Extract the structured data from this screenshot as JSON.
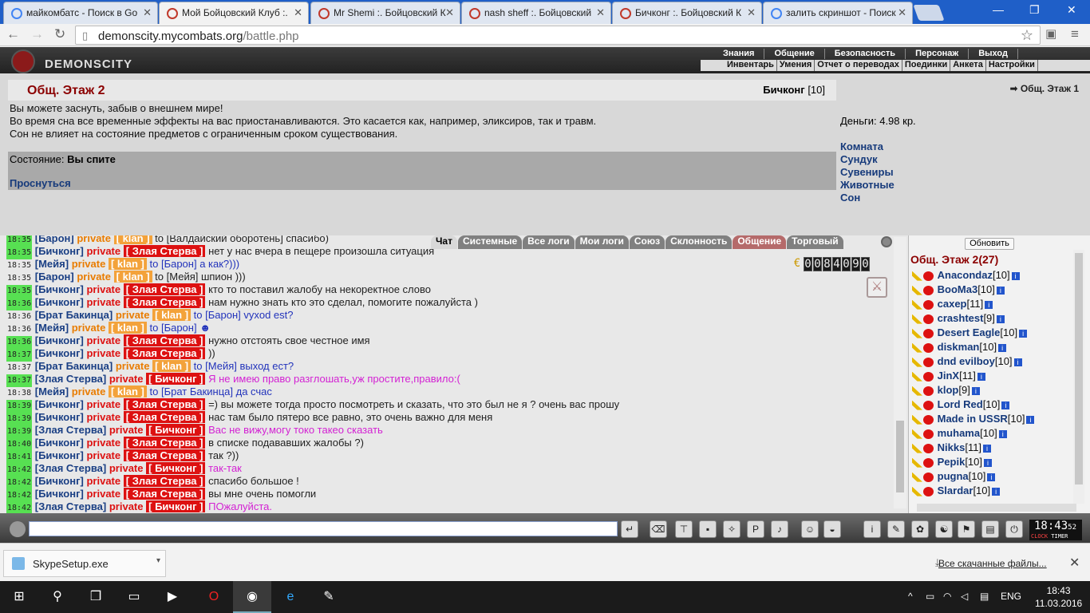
{
  "browser": {
    "tabs": [
      {
        "title": "майкомбатс - Поиск в Go",
        "icon": "google-icon"
      },
      {
        "title": "Мой Бойцовский Клуб :.",
        "icon": "combats-icon",
        "active": true
      },
      {
        "title": "Mr Shemi :. Бойцовский К",
        "icon": "combats-icon"
      },
      {
        "title": "nash sheff :. Бойцовский",
        "icon": "combats-icon"
      },
      {
        "title": "Бичконг :. Бойцовский К",
        "icon": "combats-icon"
      },
      {
        "title": "залить скриншот - Поиск",
        "icon": "google-icon"
      }
    ],
    "url_domain": "demonscity.mycombats.org",
    "url_path": "/battle.php"
  },
  "game": {
    "logo_text": "DEMONSCITY",
    "menu_top": [
      "Знания",
      "Общение",
      "Безопасность",
      "Персонаж",
      "Выход"
    ],
    "menu_sub": [
      "Инвентарь",
      "Умения",
      "Отчет о переводах",
      "Поединки",
      "Анкета",
      "Настройки"
    ],
    "room_title": "Общ. Этаж 2",
    "char_name": "Бичконг",
    "char_level": "[10]",
    "desc": [
      "Вы можете заснуть, забыв о внешнем мире!",
      "Во время сна все временные эффекты на вас приостанавливаются. Это касается как, например, эликсиров, так и травм.",
      "Сон не влияет на состояние предметов с ограниченным сроком существования."
    ],
    "state_label": "Состояние:",
    "state_value": "Вы спите",
    "wake_link": "Проснуться",
    "current_room": "Общ. Этаж 1",
    "money": "Деньги: 4.98 кр.",
    "room_links": [
      "Комната",
      "Сундук",
      "Сувениры",
      "Животные",
      "Сон"
    ]
  },
  "chat": {
    "tabs": [
      "Чат",
      "Системные",
      "Все логи",
      "Мои логи",
      "Союз",
      "Склонность",
      "Общение",
      "Торговый"
    ],
    "counter_digits": [
      "0",
      "0",
      "8",
      "4",
      "0",
      "9",
      "0"
    ],
    "messages": [
      {
        "time": "18:35",
        "hl": true,
        "nick": "Барон",
        "priv": "private",
        "tgt": "klan",
        "pc": "org",
        "text": "to [Валдайский оборотень] спасибо)",
        "mc": "dark"
      },
      {
        "time": "18:35",
        "hl": true,
        "nick": "Бичконг",
        "priv": "private",
        "tgt": "Злая Стерва",
        "pc": "red",
        "text": "нет у нас вчера в пещере произошла ситуация",
        "mc": "dark"
      },
      {
        "time": "18:35",
        "hl": false,
        "nick": "Мейя",
        "priv": "private",
        "tgt": "klan",
        "pc": "org",
        "text": "to [Барон] а как?)))",
        "mc": "blue"
      },
      {
        "time": "18:35",
        "hl": false,
        "nick": "Барон",
        "priv": "private",
        "tgt": "klan",
        "pc": "org",
        "text": "to [Мейя] шпион )))",
        "mc": "dark"
      },
      {
        "time": "18:35",
        "hl": true,
        "nick": "Бичконг",
        "priv": "private",
        "tgt": "Злая Стерва",
        "pc": "red",
        "text": "кто то поставил жалобу на некоректное слово",
        "mc": "dark"
      },
      {
        "time": "18:36",
        "hl": true,
        "nick": "Бичконг",
        "priv": "private",
        "tgt": "Злая Стерва",
        "pc": "red",
        "text": "нам нужно знать кто это сделал, помогите пожалуйста )",
        "mc": "dark"
      },
      {
        "time": "18:36",
        "hl": false,
        "nick": "Брат Бакинца",
        "priv": "private",
        "tgt": "klan",
        "pc": "org",
        "text": "to [Барон] vyxod est?",
        "mc": "blue"
      },
      {
        "time": "18:36",
        "hl": false,
        "nick": "Мейя",
        "priv": "private",
        "tgt": "klan",
        "pc": "org",
        "text": "to [Барон] ☻",
        "mc": "blue"
      },
      {
        "time": "18:36",
        "hl": true,
        "nick": "Бичконг",
        "priv": "private",
        "tgt": "Злая Стерва",
        "pc": "red",
        "text": "нужно отстоять свое честное имя",
        "mc": "dark"
      },
      {
        "time": "18:37",
        "hl": true,
        "nick": "Бичконг",
        "priv": "private",
        "tgt": "Злая Стерва",
        "pc": "red",
        "text": "))",
        "mc": "dark"
      },
      {
        "time": "18:37",
        "hl": false,
        "nick": "Брат Бакинца",
        "priv": "private",
        "tgt": "klan",
        "pc": "org",
        "text": "to [Мейя] выход ест?",
        "mc": "blue"
      },
      {
        "time": "18:37",
        "hl": true,
        "nick": "Злая Стерва",
        "priv": "private",
        "tgt": "Бичконг",
        "pc": "red",
        "text": "Я не имею право разглошать,уж простите,правило:(",
        "mc": "pink"
      },
      {
        "time": "18:38",
        "hl": false,
        "nick": "Мейя",
        "priv": "private",
        "tgt": "klan",
        "pc": "org",
        "text": "to [Брат Бакинца] да счас",
        "mc": "blue"
      },
      {
        "time": "18:39",
        "hl": true,
        "nick": "Бичконг",
        "priv": "private",
        "tgt": "Злая Стерва",
        "pc": "red",
        "text": "=) вы можете тогда просто посмотреть и сказать, что это был не я ? очень вас прошу",
        "mc": "dark"
      },
      {
        "time": "18:39",
        "hl": true,
        "nick": "Бичконг",
        "priv": "private",
        "tgt": "Злая Стерва",
        "pc": "red",
        "text": "нас там было пятеро все равно, это очень важно для меня",
        "mc": "dark"
      },
      {
        "time": "18:39",
        "hl": true,
        "nick": "Злая Стерва",
        "priv": "private",
        "tgt": "Бичконг",
        "pc": "red",
        "text": "Вас не вижу,могу токо такео сказать",
        "mc": "pink"
      },
      {
        "time": "18:40",
        "hl": true,
        "nick": "Бичконг",
        "priv": "private",
        "tgt": "Злая Стерва",
        "pc": "red",
        "text": "в списке подававших жалобы ?)",
        "mc": "dark"
      },
      {
        "time": "18:41",
        "hl": true,
        "nick": "Бичконг",
        "priv": "private",
        "tgt": "Злая Стерва",
        "pc": "red",
        "text": "так ?))",
        "mc": "dark"
      },
      {
        "time": "18:42",
        "hl": true,
        "nick": "Злая Стерва",
        "priv": "private",
        "tgt": "Бичконг",
        "pc": "red",
        "text": "так-так",
        "mc": "pink"
      },
      {
        "time": "18:42",
        "hl": true,
        "nick": "Бичконг",
        "priv": "private",
        "tgt": "Злая Стерва",
        "pc": "red",
        "text": "спасибо большое !",
        "mc": "dark"
      },
      {
        "time": "18:42",
        "hl": true,
        "nick": "Бичконг",
        "priv": "private",
        "tgt": "Злая Стерва",
        "pc": "red",
        "text": "вы мне очень помогли",
        "mc": "dark"
      },
      {
        "time": "18:42",
        "hl": true,
        "nick": "Злая Стерва",
        "priv": "private",
        "tgt": "Бичконг",
        "pc": "red",
        "text": "ПОжалуйста.",
        "mc": "pink"
      }
    ]
  },
  "players": {
    "refresh": "Обновить",
    "header": "Общ. Этаж 2(27)",
    "list": [
      {
        "name": "Anacondaz",
        "lvl": "[10]"
      },
      {
        "name": "BooMa3",
        "lvl": "[10]"
      },
      {
        "name": "caxep",
        "lvl": "[11]"
      },
      {
        "name": "crashtest",
        "lvl": "[9]"
      },
      {
        "name": "Desert Eagle",
        "lvl": "[10]"
      },
      {
        "name": "diskman",
        "lvl": "[10]"
      },
      {
        "name": "dnd evilboy",
        "lvl": "[10]"
      },
      {
        "name": "JinX",
        "lvl": "[11]"
      },
      {
        "name": "klop",
        "lvl": "[9]"
      },
      {
        "name": "Lord Red",
        "lvl": "[10]"
      },
      {
        "name": "Made in USSR",
        "lvl": "[10]"
      },
      {
        "name": "muhama",
        "lvl": "[10]"
      },
      {
        "name": "Nikks",
        "lvl": "[11]"
      },
      {
        "name": "Pepik",
        "lvl": "[10]"
      },
      {
        "name": "pugna",
        "lvl": "[10]"
      },
      {
        "name": "Slardar",
        "lvl": "[10]"
      }
    ]
  },
  "clock": {
    "time": "18:43",
    "sec": "52",
    "label1": "CLOCK",
    "label2": "TIMER"
  },
  "download": {
    "file": "SkypeSetup.exe",
    "all": "Все скачанные файлы..."
  },
  "taskbar": {
    "time": "18:43",
    "date": "11.03.2016",
    "lang": "ENG"
  }
}
